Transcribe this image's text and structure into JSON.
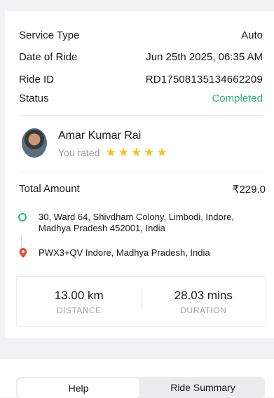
{
  "ride": {
    "service_type_label": "Service Type",
    "service_type_value": "Auto",
    "date_label": "Date of Ride",
    "date_value": "Jun 25th 2025, 06:35 AM",
    "ride_id_label": "Ride ID",
    "ride_id_value": "RD17508135134662209",
    "status_label": "Status",
    "status_value": "Completed",
    "status_color": "#2bb673"
  },
  "driver": {
    "name": "Amar Kumar Rai",
    "rated_label": "You rated",
    "rating": 5,
    "stars": "★★★★★",
    "star_color": "#f5c518"
  },
  "fare": {
    "total_label": "Total Amount",
    "total_value": "₹229.0"
  },
  "route": {
    "pickup": "30, Ward 64, Shivdham Colony, Limbodi, Indore, Madhya Pradesh 452001, India",
    "drop": "PWX3+QV Indore, Madhya Pradesh, India",
    "pickup_icon": "green-circle-pin-icon",
    "drop_icon": "red-location-pin-icon"
  },
  "stats": {
    "distance_value": "13.00 km",
    "distance_label": "DISTANCE",
    "duration_value": "28.03 mins",
    "duration_label": "DURATION"
  },
  "tabs": {
    "help": "Help",
    "summary": "Ride Summary",
    "active": "Help"
  }
}
